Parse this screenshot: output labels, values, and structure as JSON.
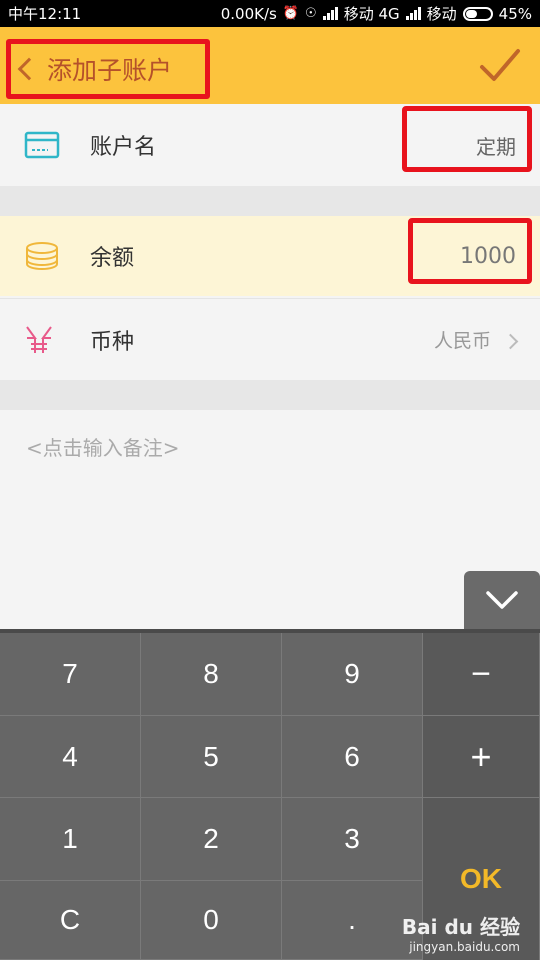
{
  "status_bar": {
    "time": "中午12:11",
    "speed": "0.00K/s",
    "carrier1": "移动 4G",
    "carrier2": "移动",
    "battery": "45%"
  },
  "header": {
    "title": "添加子账户"
  },
  "form": {
    "name_label": "账户名",
    "name_value": "定期",
    "balance_label": "余额",
    "balance_value": "1000",
    "currency_label": "币种",
    "currency_value": "人民币",
    "note_placeholder": "<点击输入备注>"
  },
  "keypad": {
    "keys": [
      "7",
      "8",
      "9",
      "4",
      "5",
      "6",
      "1",
      "2",
      "3",
      "C",
      "0",
      "."
    ],
    "minus": "−",
    "plus": "+",
    "ok": "OK"
  },
  "watermark": {
    "main": "Bai du 经验",
    "sub": "jingyan.baidu.com"
  },
  "colors": {
    "header_bg": "#fcc33d",
    "highlight": "#e8131d",
    "ok_text": "#f3b928",
    "keypad_bg": "#666666"
  }
}
